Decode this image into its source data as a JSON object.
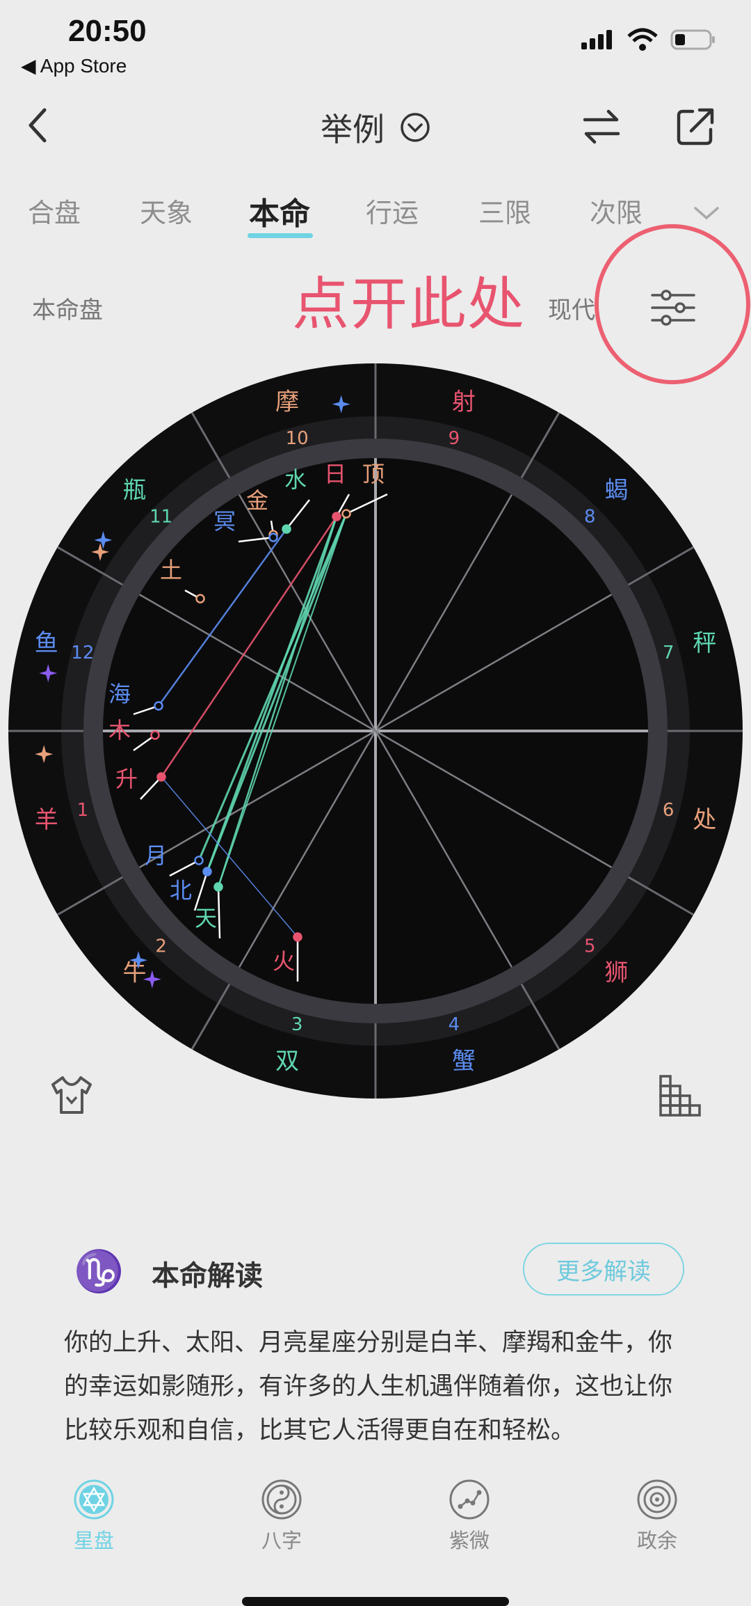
{
  "status": {
    "time": "20:50",
    "back_app": "◀ App Store"
  },
  "header": {
    "title": "举例"
  },
  "tabs": [
    {
      "label": "合盘",
      "active": false
    },
    {
      "label": "天象",
      "active": false
    },
    {
      "label": "本命",
      "active": true
    },
    {
      "label": "行运",
      "active": false
    },
    {
      "label": "三限",
      "active": false
    },
    {
      "label": "次限",
      "active": false
    }
  ],
  "subheader": {
    "left": "本命盘",
    "annotation": "点开此处",
    "mode": "现代"
  },
  "chart": {
    "signs": [
      {
        "label": "摩",
        "color": "#e8a07a"
      },
      {
        "label": "射",
        "color": "#e8546f"
      },
      {
        "label": "蝎",
        "color": "#5b8cf0"
      },
      {
        "label": "秤",
        "color": "#5fd6b0"
      },
      {
        "label": "处",
        "color": "#e8a07a"
      },
      {
        "label": "狮",
        "color": "#e8546f"
      },
      {
        "label": "蟹",
        "color": "#5b8cf0"
      },
      {
        "label": "双",
        "color": "#5fd6b0"
      },
      {
        "label": "牛",
        "color": "#e8a07a"
      },
      {
        "label": "羊",
        "color": "#e8546f"
      },
      {
        "label": "鱼",
        "color": "#5b8cf0"
      },
      {
        "label": "瓶",
        "color": "#5fd6b0"
      }
    ],
    "houses": [
      {
        "label": "10",
        "color": "#e8a07a"
      },
      {
        "label": "9",
        "color": "#e8546f"
      },
      {
        "label": "8",
        "color": "#5b8cf0"
      },
      {
        "label": "7",
        "color": "#5fd6b0"
      },
      {
        "label": "6",
        "color": "#e8a07a"
      },
      {
        "label": "5",
        "color": "#e8546f"
      },
      {
        "label": "4",
        "color": "#5b8cf0"
      },
      {
        "label": "3",
        "color": "#5fd6b0"
      },
      {
        "label": "2",
        "color": "#e8a07a"
      },
      {
        "label": "1",
        "color": "#e8546f"
      },
      {
        "label": "12",
        "color": "#5b8cf0"
      },
      {
        "label": "11",
        "color": "#5fd6b0"
      }
    ],
    "planets": [
      {
        "label": "顶",
        "color": "#e8a07a"
      },
      {
        "label": "日",
        "color": "#e8546f"
      },
      {
        "label": "水",
        "color": "#5fd6b0"
      },
      {
        "label": "金",
        "color": "#e8a07a"
      },
      {
        "label": "冥",
        "color": "#5b8cf0"
      },
      {
        "label": "土",
        "color": "#e8a07a"
      },
      {
        "label": "海",
        "color": "#5b8cf0"
      },
      {
        "label": "木",
        "color": "#e8546f"
      },
      {
        "label": "升",
        "color": "#e8546f"
      },
      {
        "label": "月",
        "color": "#5b8cf0"
      },
      {
        "label": "北",
        "color": "#5b8cf0"
      },
      {
        "label": "天",
        "color": "#5fd6b0"
      },
      {
        "label": "火",
        "color": "#e8546f"
      }
    ],
    "star_colors": [
      "#5b8cf0",
      "#e8a07a",
      "#8b5cf0"
    ]
  },
  "reading": {
    "sign_glyph": "♑",
    "title": "本命解读",
    "more": "更多解读",
    "body": "你的上升、太阳、月亮星座分别是白羊、摩羯和金牛，你的幸运如影随形，有许多的人生机遇伴随着你，这也让你比较乐观和自信，比其它人活得更自在和轻松。"
  },
  "nav": [
    {
      "label": "星盘",
      "icon": "star-of-david-icon",
      "active": true
    },
    {
      "label": "八字",
      "icon": "yin-yang-icon",
      "active": false
    },
    {
      "label": "紫微",
      "icon": "constellation-icon",
      "active": false
    },
    {
      "label": "政余",
      "icon": "dial-icon",
      "active": false
    }
  ],
  "colors": {
    "accent": "#6fd3e4",
    "annotation": "#e8546f"
  }
}
